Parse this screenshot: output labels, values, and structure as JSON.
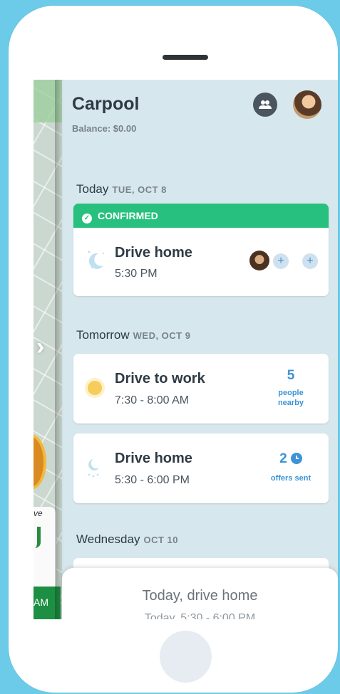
{
  "app": {
    "title": "Carpool",
    "balance": "Balance: $0.00"
  },
  "today": {
    "day": "Today",
    "date": "TUE, OCT 8",
    "status": "CONFIRMED",
    "ride": {
      "title": "Drive home",
      "time": "5:30 PM"
    }
  },
  "tomorrow": {
    "day": "Tomorrow",
    "date": "WED, OCT 9",
    "rides": [
      {
        "title": "Drive to work",
        "time": "7:30 - 8:00 AM",
        "stat_value": "5",
        "stat_label_1": "people",
        "stat_label_2": "nearby"
      },
      {
        "title": "Drive home",
        "time": "5:30 - 6:00 PM",
        "stat_value": "2",
        "stat_label_1": "offers sent"
      }
    ]
  },
  "wednesday": {
    "day": "Wednesday",
    "date": "OCT 10"
  },
  "bottom_sheet": {
    "title": "Today, drive home",
    "subtitle": "Today, 5:30 - 6:00 PM"
  },
  "map": {
    "chip_text": "AM",
    "label_fragment": "ve"
  },
  "colors": {
    "accent": "#3c94d6",
    "confirmed": "#27c07f",
    "background": "#6ccbe8"
  }
}
